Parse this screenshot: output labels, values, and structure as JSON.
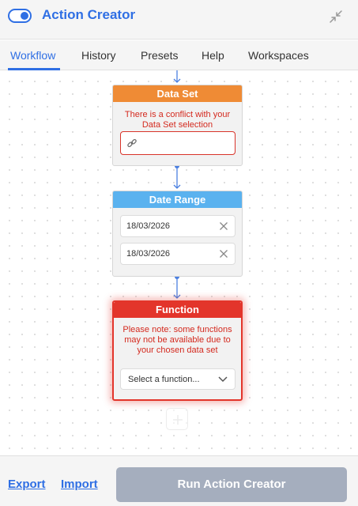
{
  "header": {
    "title": "Action Creator",
    "toggle_on": true,
    "accent_color": "#2f6fe4",
    "collapse_icon": "collapse-icon"
  },
  "tabs": [
    {
      "label": "Workflow",
      "active": true
    },
    {
      "label": "History",
      "active": false
    },
    {
      "label": "Presets",
      "active": false
    },
    {
      "label": "Help",
      "active": false
    },
    {
      "label": "Workspaces",
      "active": false
    }
  ],
  "nodes": {
    "data_set": {
      "title": "Data Set",
      "color": "#ef8b35",
      "warning": "There is a conflict with your Data Set selection",
      "field_icon": "link-icon",
      "field_value": ""
    },
    "date_range": {
      "title": "Date Range",
      "color": "#5ab2ef",
      "start": "18/03/2026",
      "end": "18/03/2026"
    },
    "function": {
      "title": "Function",
      "color": "#e3352b",
      "warning": "Please note: some functions may not be available due to your chosen data set",
      "select_placeholder": "Select a function..."
    }
  },
  "footer": {
    "export_label": "Export",
    "import_label": "Import",
    "run_label": "Run Action Creator",
    "run_enabled": false
  }
}
